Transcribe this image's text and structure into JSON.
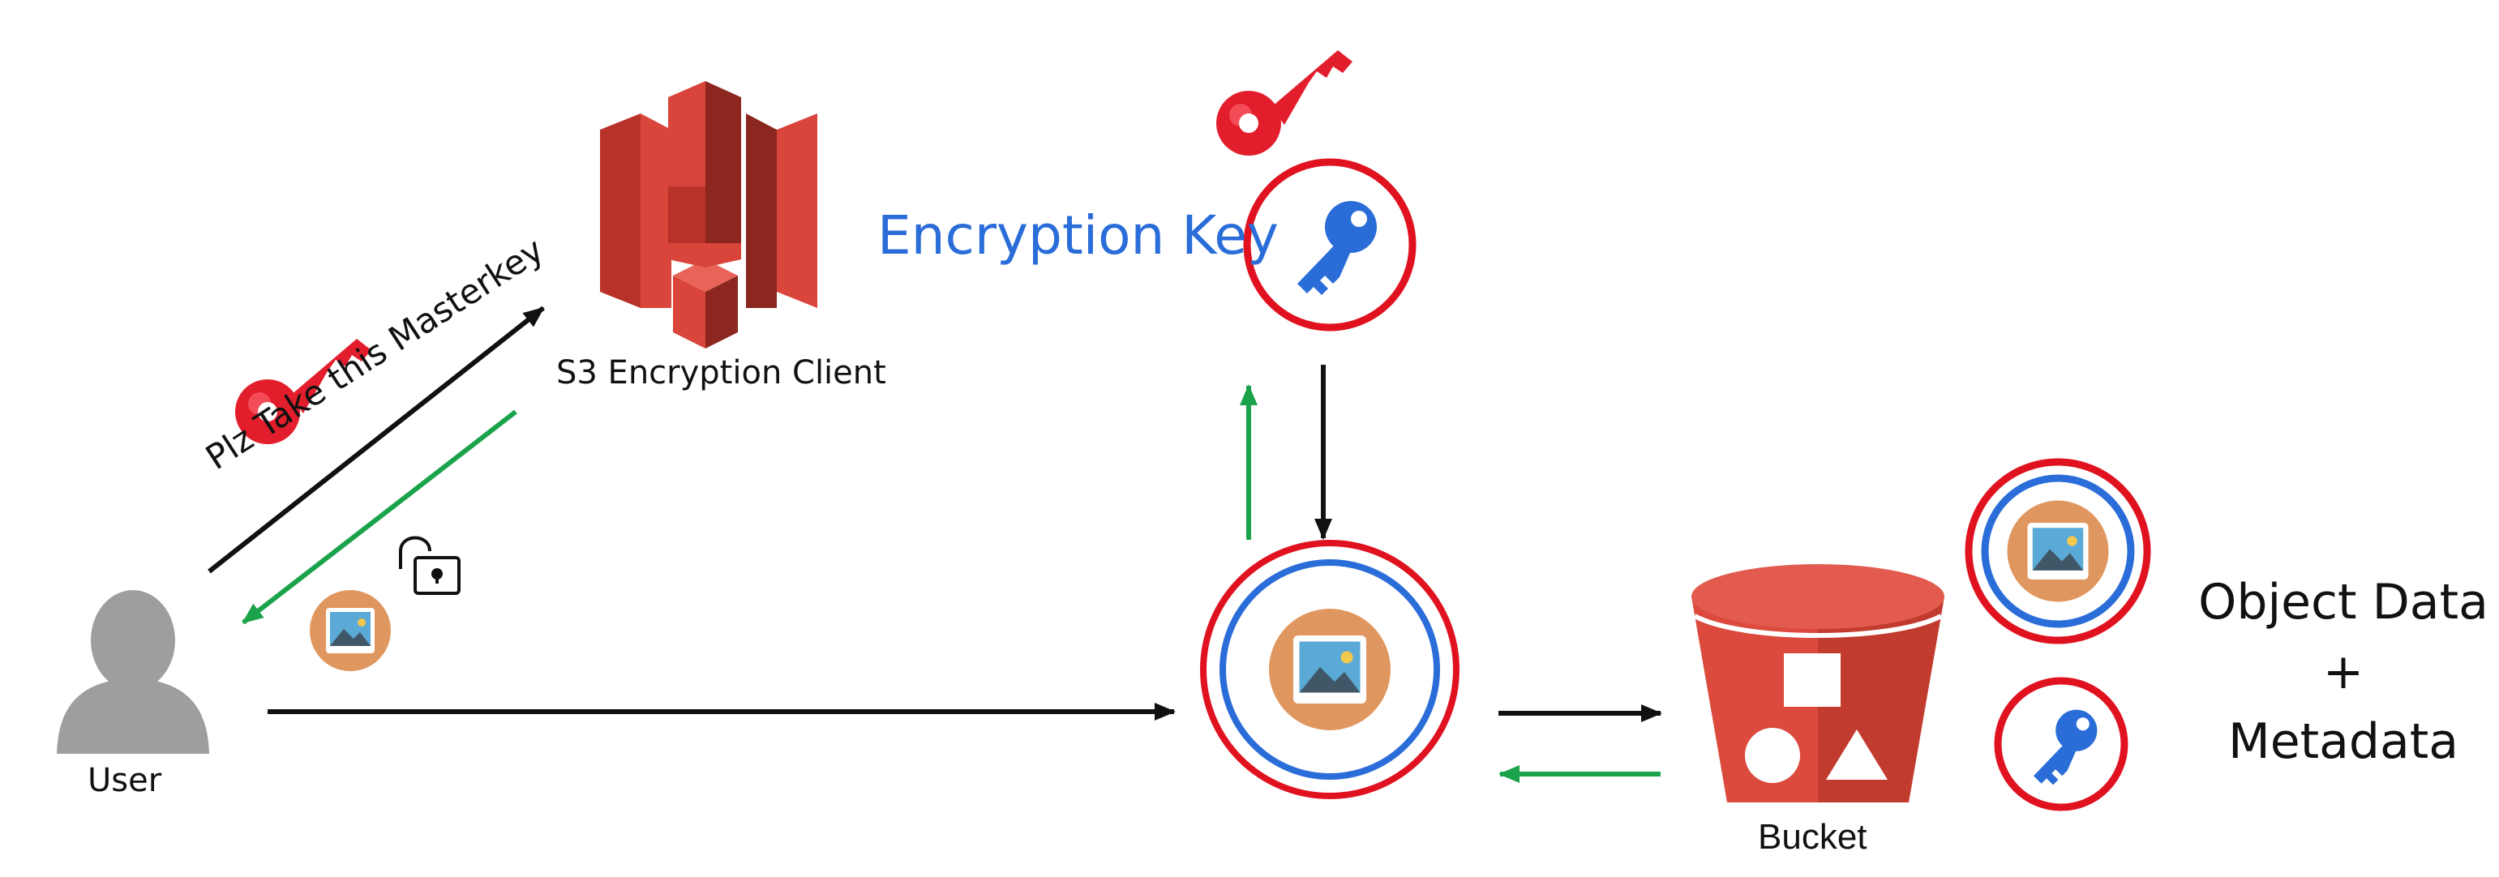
{
  "labels": {
    "user": "User",
    "s3_client": "S3 Encryption Client",
    "encryption_key": "Encryption Key",
    "masterkey_arrow": "Plz Take this Masterkey",
    "bucket": "Bucket",
    "object_data": "Object Data",
    "plus": "+",
    "metadata": "Metadata"
  },
  "colors": {
    "encryption_key_text": "#2a6dd9",
    "red_ring": "#e0121f",
    "blue_ring": "#2a6dd9",
    "return_arrow": "#1aa34a",
    "s3_red": "#d9453a",
    "bucket_red": "#db4a3d",
    "image_badge": "#e0975f"
  },
  "icons": [
    "user-icon",
    "s3-bucket-logo-icon",
    "master-key-icon",
    "encryption-key-icon",
    "unlock-icon",
    "image-icon",
    "bucket-icon"
  ]
}
